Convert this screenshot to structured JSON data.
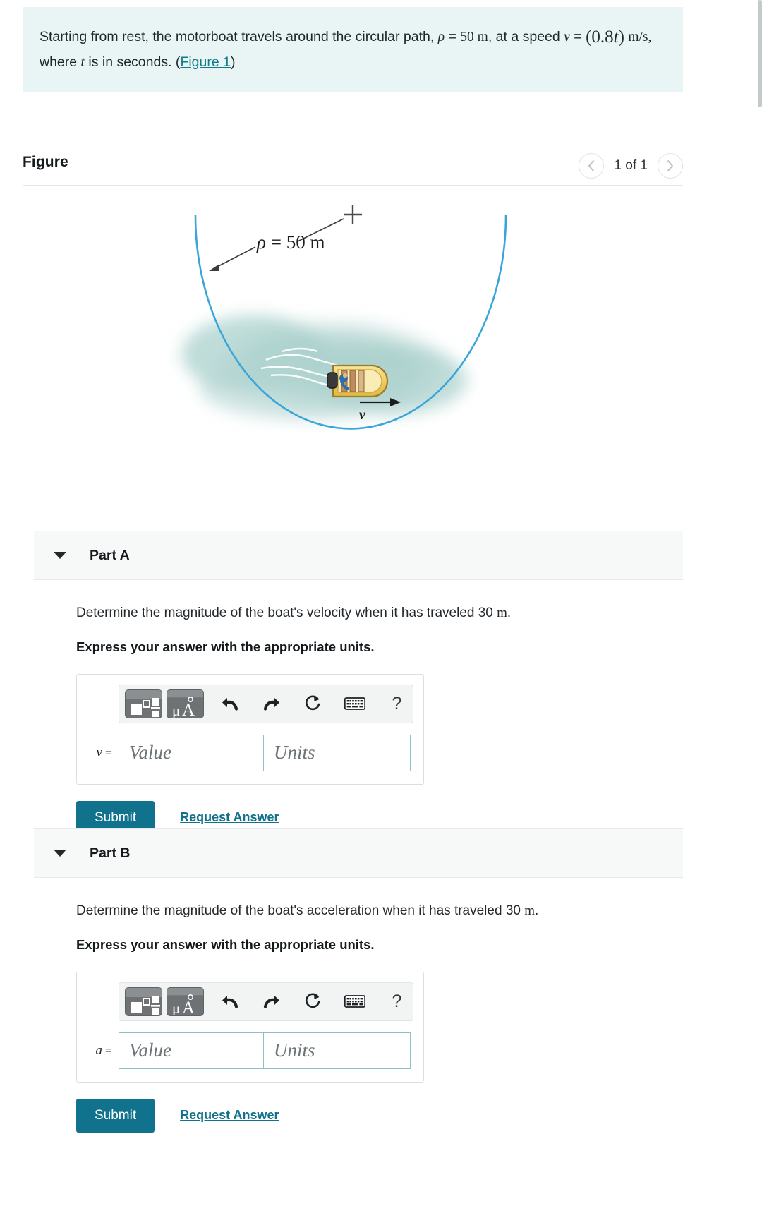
{
  "problem": {
    "line1_a": "Starting from rest, the motorboat travels around the circular path, ",
    "rho_sym": "ρ",
    "line1_b": " = 50 m, at a speed ",
    "v_sym": "v",
    "eq": "=",
    "speed_open": "(",
    "speed_val": "0.8",
    "speed_t": "t",
    "speed_close": ")",
    "units_ms": "m/s,",
    "line2_a": "where ",
    "t_sym": "t",
    "line2_b": " is in seconds. (",
    "figure_link": "Figure 1",
    "line2_c": ")"
  },
  "figure": {
    "title": "Figure",
    "count_label": "1 of 1",
    "prev_icon": "chevron-left-icon",
    "next_icon": "chevron-right-icon",
    "radius_label": "ρ = 50 m",
    "center_marker": "+",
    "velocity_label": "v"
  },
  "parts": [
    {
      "id": "a",
      "header": "Part A",
      "caret_icon": "caret-down-icon",
      "question_pre": "Determine the magnitude of the boat's velocity when it has traveled 30 ",
      "question_unit": "m",
      "question_post": ".",
      "instruction": "Express your answer with the appropriate units.",
      "variable": "v",
      "equals": "=",
      "value_placeholder": "Value",
      "units_placeholder": "Units",
      "value": "",
      "units": "",
      "submit_label": "Submit",
      "request_label": "Request Answer"
    },
    {
      "id": "b",
      "header": "Part B",
      "caret_icon": "caret-down-icon",
      "question_pre": "Determine the magnitude of the boat's acceleration when it has traveled 30 ",
      "question_unit": "m",
      "question_post": ".",
      "instruction": "Express your answer with the appropriate units.",
      "variable": "a",
      "equals": "=",
      "value_placeholder": "Value",
      "units_placeholder": "Units",
      "value": "",
      "units": "",
      "submit_label": "Submit",
      "request_label": "Request Answer"
    }
  ],
  "toolbar": {
    "template_icon": "math-template-icon",
    "units_icon": "micro-angstrom-units-icon",
    "undo_icon": "undo-arrow-icon",
    "redo_icon": "redo-arrow-icon",
    "reset_icon": "reset-circular-arrow-icon",
    "keyboard_icon": "keyboard-icon",
    "help_label": "?"
  },
  "colors": {
    "statement_bg": "#e9f5f4",
    "accent": "#10728c",
    "link": "#0f7b8a",
    "input_border": "#8fc0c6",
    "water": "#a8cfcb",
    "path": "#3aa5d9",
    "boat": "#f5d87a"
  }
}
